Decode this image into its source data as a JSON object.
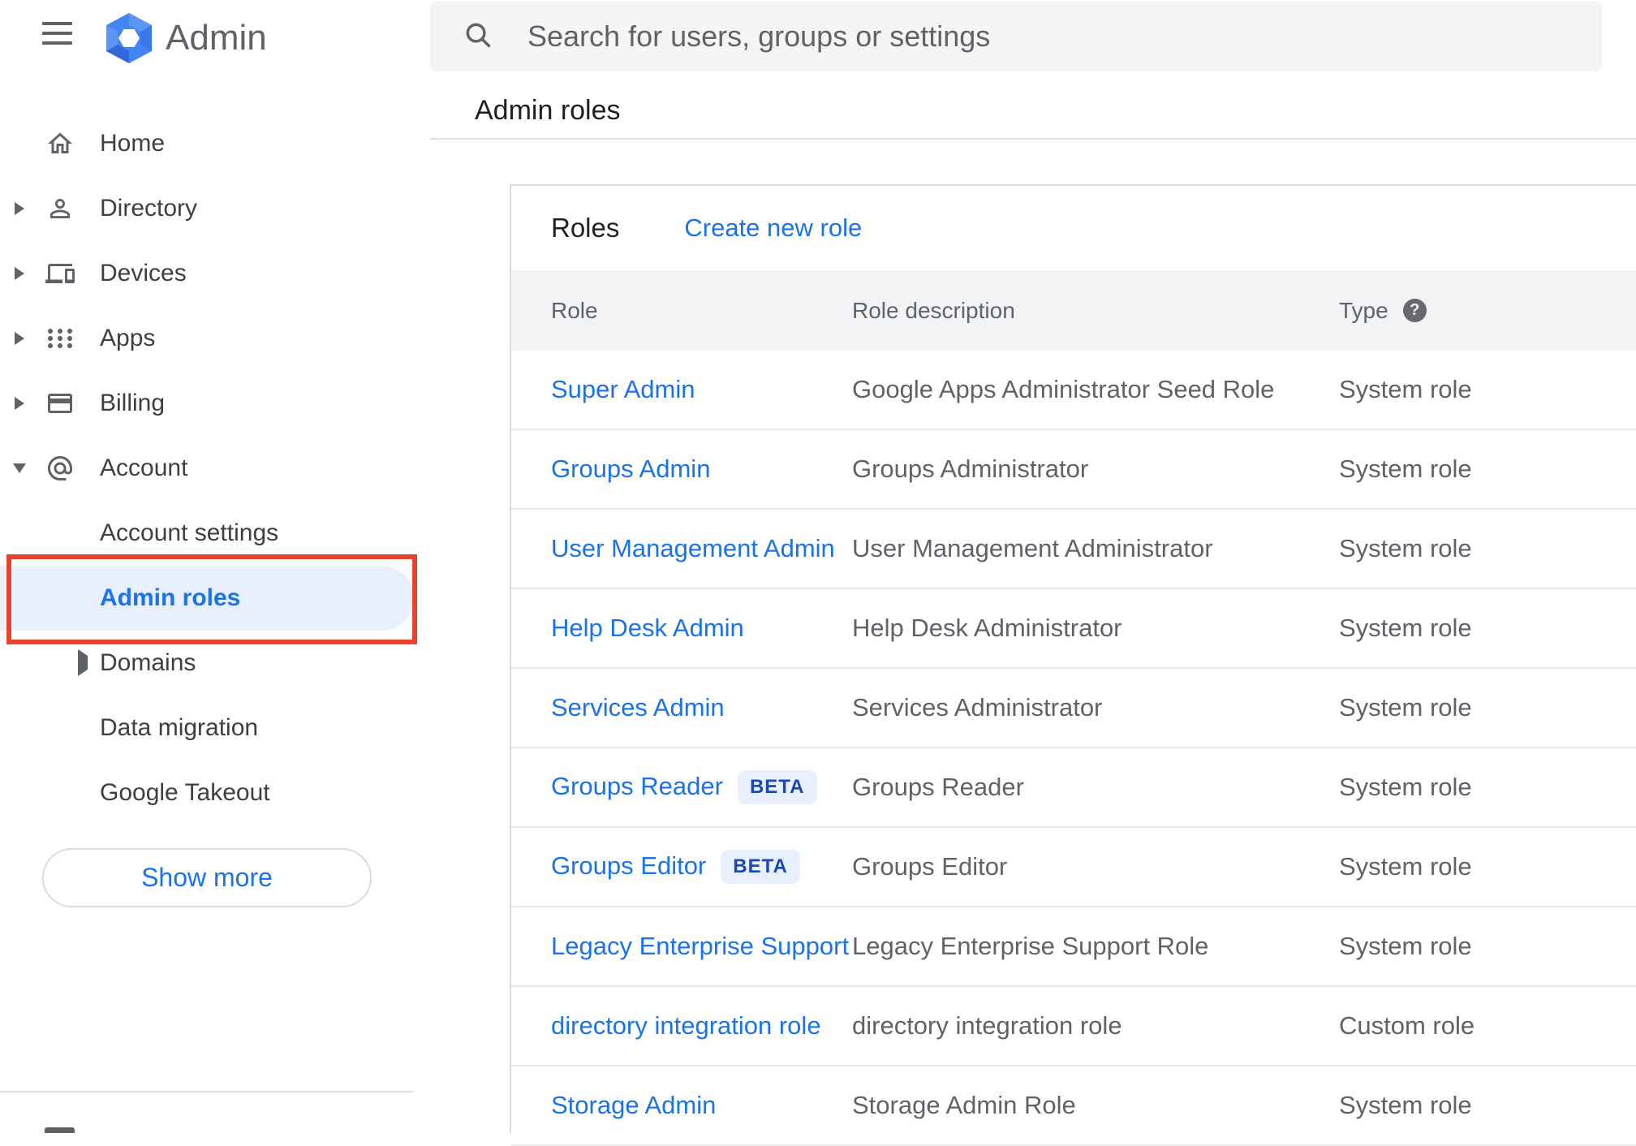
{
  "app": {
    "title": "Admin"
  },
  "search": {
    "placeholder": "Search for users, groups or settings"
  },
  "breadcrumb": "Admin roles",
  "sidebar": {
    "items": [
      {
        "label": "Home",
        "icon": "home",
        "arrow": "none",
        "level": 0,
        "selected": false
      },
      {
        "label": "Directory",
        "icon": "person",
        "arrow": "right",
        "level": 0,
        "selected": false
      },
      {
        "label": "Devices",
        "icon": "devices",
        "arrow": "right",
        "level": 0,
        "selected": false
      },
      {
        "label": "Apps",
        "icon": "apps",
        "arrow": "right",
        "level": 0,
        "selected": false
      },
      {
        "label": "Billing",
        "icon": "card",
        "arrow": "right",
        "level": 0,
        "selected": false
      },
      {
        "label": "Account",
        "icon": "at",
        "arrow": "down",
        "level": 0,
        "selected": false
      },
      {
        "label": "Account settings",
        "icon": "",
        "arrow": "none",
        "level": 1,
        "selected": false
      },
      {
        "label": "Admin roles",
        "icon": "",
        "arrow": "none",
        "level": 1,
        "selected": true
      },
      {
        "label": "Domains",
        "icon": "",
        "arrow": "right",
        "level": 2,
        "selected": false
      },
      {
        "label": "Data migration",
        "icon": "",
        "arrow": "none",
        "level": 1,
        "selected": false
      },
      {
        "label": "Google Takeout",
        "icon": "",
        "arrow": "none",
        "level": 1,
        "selected": false
      }
    ],
    "show_more_label": "Show more"
  },
  "roles_panel": {
    "title": "Roles",
    "create_link": "Create new role",
    "columns": {
      "role": "Role",
      "description": "Role description",
      "type": "Type"
    },
    "beta_label": "BETA",
    "rows": [
      {
        "role": "Super Admin",
        "description": "Google Apps Administrator Seed Role",
        "type": "System role",
        "beta": false
      },
      {
        "role": "Groups Admin",
        "description": "Groups Administrator",
        "type": "System role",
        "beta": false
      },
      {
        "role": "User Management Admin",
        "description": "User Management Administrator",
        "type": "System role",
        "beta": false
      },
      {
        "role": "Help Desk Admin",
        "description": "Help Desk Administrator",
        "type": "System role",
        "beta": false
      },
      {
        "role": "Services Admin",
        "description": "Services Administrator",
        "type": "System role",
        "beta": false
      },
      {
        "role": "Groups Reader",
        "description": "Groups Reader",
        "type": "System role",
        "beta": true
      },
      {
        "role": "Groups Editor",
        "description": "Groups Editor",
        "type": "System role",
        "beta": true
      },
      {
        "role": "Legacy Enterprise Support",
        "description": "Legacy Enterprise Support Role",
        "type": "System role",
        "beta": false
      },
      {
        "role": "directory integration role",
        "description": "directory integration role",
        "type": "Custom role",
        "beta": false
      },
      {
        "role": "Storage Admin",
        "description": "Storage Admin Role",
        "type": "System role",
        "beta": false
      }
    ]
  },
  "colors": {
    "accent": "#1a73e8",
    "selected_bg": "#e8f0fe",
    "annotation_red": "#e8432c",
    "beta_bg": "#e8f0fe",
    "beta_text": "#1948b3",
    "header_bg": "#f1f3f4"
  }
}
